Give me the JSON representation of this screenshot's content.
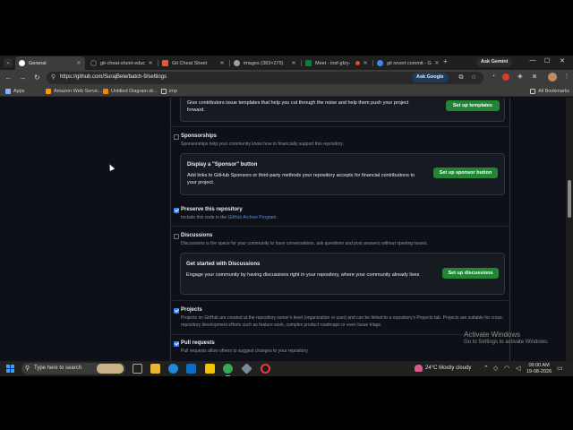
{
  "browser": {
    "tabs": [
      {
        "label": "General",
        "color": "#ffffff",
        "active": true
      },
      {
        "label": "git-cheat-sheet-educ",
        "color": "#1f1f1f"
      },
      {
        "label": "Git Cheat Sheet",
        "color": "#f05033"
      },
      {
        "label": "images (383×275)",
        "color": "#9aa0a6"
      },
      {
        "label": "Meet - insf-gfzy-",
        "color": "#00832d"
      },
      {
        "label": "git revert commit - G",
        "color": "#4285f4"
      }
    ],
    "new_tab": "+",
    "ask_gemini": "Ask Gemini",
    "url": "https://github.com/SurajBele/batch-9/settings",
    "ask_google": "Ask Google",
    "bookmarks": [
      {
        "label": "Apps",
        "color": "#8ab4f8"
      },
      {
        "label": "Amazon Web Servic...",
        "color": "#ff9900"
      },
      {
        "label": "Untitled Diagram.dr...",
        "color": "#f08705"
      },
      {
        "label": "imp",
        "color": "#c8c8c8"
      }
    ],
    "all_bookmarks": "All Bookmarks"
  },
  "settings": {
    "templates_desc": "Give contributors issue templates that help you cut through the noise and help them push your project forward.",
    "templates_button": "Set up templates",
    "sponsorships": {
      "title": "Sponsorships",
      "desc": "Sponsorships help your community know how to financially support this repository.",
      "checked": false,
      "card_title": "Display a \"Sponsor\" button",
      "card_desc": "Add links to GitHub Sponsors or third-party methods your repository accepts for financial contributions to your project.",
      "button": "Set up sponsor button"
    },
    "preserve": {
      "title": "Preserve this repository",
      "desc_prefix": "Include this code in the ",
      "desc_link": "GitHub Archive Program",
      "desc_suffix": ".",
      "checked": true
    },
    "discussions": {
      "title": "Discussions",
      "desc": "Discussions is the space for your community to have conversations, ask questions and post answers without opening issues.",
      "checked": false,
      "card_title": "Get started with Discussions",
      "card_desc": "Engage your community by having discussions right in your repository, where your community already lives",
      "button": "Set up discussions"
    },
    "projects": {
      "title": "Projects",
      "desc": "Projects on GitHub are created at the repository owner's level (organization or user) and can be linked to a repository's Projects tab. Projects are suitable for cross-repository development efforts such as feature work, complex product roadmaps or even Issue triage.",
      "checked": true
    },
    "pull_requests": {
      "title": "Pull requests",
      "desc": "Pull requests allow others to suggest changes to your repository.",
      "checked": true
    }
  },
  "watermark": {
    "title": "Activate Windows",
    "subtitle": "Go to Settings to activate Windows."
  },
  "taskbar": {
    "search_placeholder": "Type here to search",
    "weather": "24°C  Mostly cloudy",
    "time": "09:00 AM",
    "date": "19-08-2026"
  }
}
